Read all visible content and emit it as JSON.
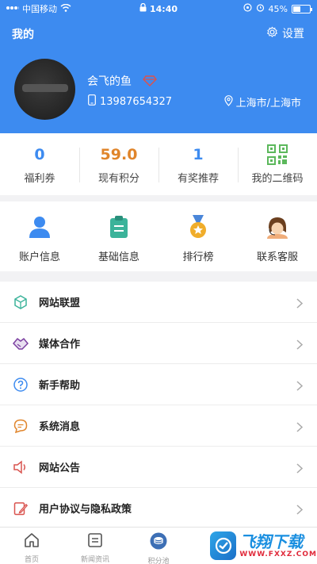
{
  "status_bar": {
    "carrier": "中国移动",
    "time": "14:40",
    "battery": "45%",
    "battery_level": 0.45
  },
  "header": {
    "title": "我的",
    "settings_label": "设置",
    "nickname": "会飞的鱼",
    "phone": "13987654327",
    "location": "上海市/上海市"
  },
  "stats": [
    {
      "value": "0",
      "label": "福利券",
      "color": "#3d8bf0"
    },
    {
      "value": "59.0",
      "label": "现有积分",
      "color": "#e0852b"
    },
    {
      "value": "1",
      "label": "有奖推荐",
      "color": "#3d8bf0"
    },
    {
      "label": "我的二维码",
      "icon": "qr-code-icon",
      "color": "#5cb85c"
    }
  ],
  "quick_actions": [
    {
      "label": "账户信息",
      "icon": "user-icon",
      "color": "#3d8bf0"
    },
    {
      "label": "基础信息",
      "icon": "clipboard-icon",
      "color": "#3bb39a"
    },
    {
      "label": "排行榜",
      "icon": "medal-icon",
      "color": "#f0ad2b"
    },
    {
      "label": "联系客服",
      "icon": "customer-service-icon",
      "color": "#7a4a22"
    }
  ],
  "menu": [
    {
      "label": "网站联盟",
      "icon": "cube-icon",
      "color": "#3bb39a"
    },
    {
      "label": "媒体合作",
      "icon": "handshake-icon",
      "color": "#7b3fa0"
    },
    {
      "label": "新手帮助",
      "icon": "help-icon",
      "color": "#3d8bf0"
    },
    {
      "label": "系统消息",
      "icon": "message-icon",
      "color": "#e0852b"
    },
    {
      "label": "网站公告",
      "icon": "speaker-icon",
      "color": "#d9534f"
    },
    {
      "label": "用户协议与隐私政策",
      "icon": "agreement-icon",
      "color": "#d9534f"
    }
  ],
  "tabbar": [
    {
      "label": "首页",
      "icon": "home-icon"
    },
    {
      "label": "新闻资讯",
      "icon": "news-icon"
    },
    {
      "label": "积分池",
      "icon": "points-icon"
    }
  ],
  "watermark": {
    "brand": "飞翔下载",
    "url": "WWW.FXXZ.COM"
  }
}
